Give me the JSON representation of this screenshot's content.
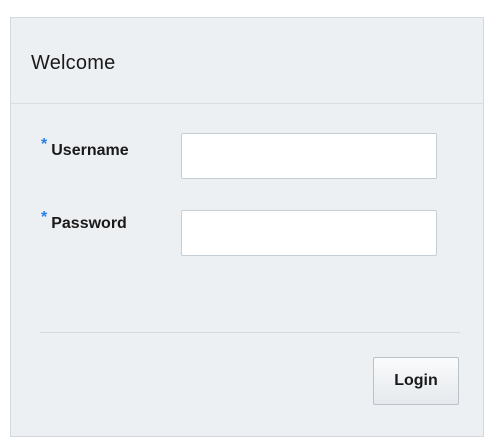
{
  "panel": {
    "title": "Welcome"
  },
  "form": {
    "required_marker": "*",
    "username_label": "Username",
    "username_value": "",
    "password_label": "Password",
    "password_value": "",
    "login_label": "Login"
  },
  "colors": {
    "panel_background": "#edf0f3",
    "required_marker": "#2a7ee6",
    "border": "#d3d9df"
  }
}
